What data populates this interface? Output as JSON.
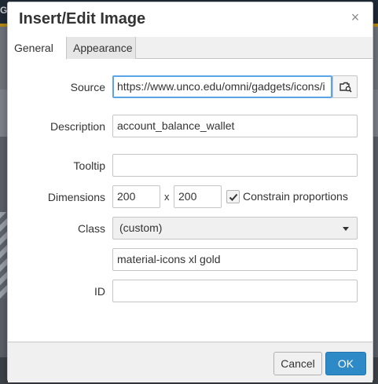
{
  "background": {
    "partial_letter": "G"
  },
  "dialog": {
    "title": "Insert/Edit Image",
    "close_glyph": "×",
    "tabs": [
      {
        "label": "General",
        "active": true
      },
      {
        "label": "Appearance",
        "active": false
      }
    ]
  },
  "form": {
    "source": {
      "label": "Source",
      "value": "https://www.unco.edu/omni/gadgets/icons/i",
      "browse_icon": "browse-folder-icon"
    },
    "description": {
      "label": "Description",
      "value": "account_balance_wallet"
    },
    "tooltip": {
      "label": "Tooltip",
      "value": ""
    },
    "dimensions": {
      "label": "Dimensions",
      "width": "200",
      "separator": "x",
      "height": "200",
      "constrain_label": "Constrain proportions",
      "constrain_checked": true
    },
    "class": {
      "label": "Class",
      "selected": "(custom)",
      "custom_value": "material-icons xl gold"
    },
    "id": {
      "label": "ID",
      "value": ""
    }
  },
  "footer": {
    "cancel_label": "Cancel",
    "ok_label": "OK"
  },
  "colors": {
    "accent_blue": "#2d8ac7",
    "focus_blue": "#59a5e5",
    "gold": "#b58a12"
  }
}
